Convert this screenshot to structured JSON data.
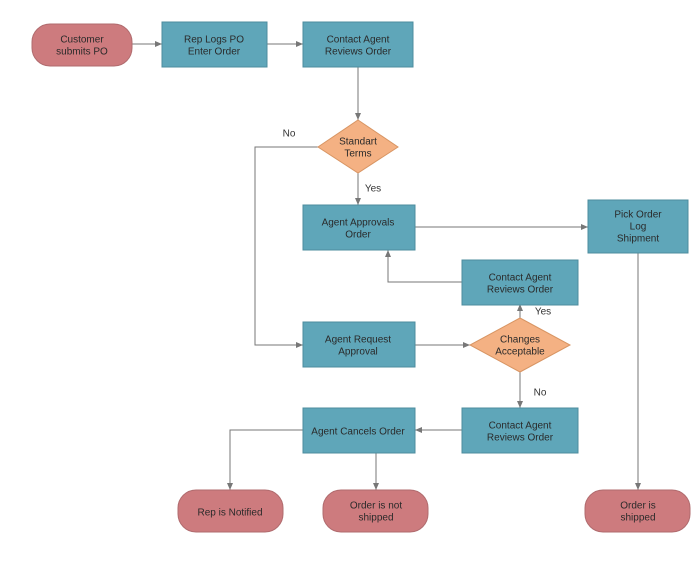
{
  "nodes": {
    "start": {
      "type": "terminator",
      "text": [
        "Customer",
        "submits PO"
      ]
    },
    "repLogs": {
      "type": "process",
      "text": [
        "Rep Logs PO",
        "Enter Order"
      ]
    },
    "contactReview1": {
      "type": "process",
      "text": [
        "Contact Agent",
        "Reviews Order"
      ]
    },
    "standardTerms": {
      "type": "decision",
      "text": [
        "Standart",
        "Terms"
      ]
    },
    "agentApprovals": {
      "type": "process",
      "text": [
        "Agent Approvals",
        "Order"
      ]
    },
    "pickOrder": {
      "type": "process",
      "text": [
        "Pick Order",
        "Log",
        "Shipment"
      ]
    },
    "contactReview2": {
      "type": "process",
      "text": [
        "Contact Agent",
        "Reviews Order"
      ]
    },
    "agentRequest": {
      "type": "process",
      "text": [
        "Agent Request",
        "Approval"
      ]
    },
    "changesAccept": {
      "type": "decision",
      "text": [
        "Changes",
        "Acceptable"
      ]
    },
    "agentCancels": {
      "type": "process",
      "text": [
        "Agent Cancels Order"
      ]
    },
    "contactReview3": {
      "type": "process",
      "text": [
        "Contact Agent",
        "Reviews Order"
      ]
    },
    "repNotified": {
      "type": "terminator",
      "text": [
        "Rep is Notified"
      ]
    },
    "orderNotShipped": {
      "type": "terminator",
      "text": [
        "Order is not",
        "shipped"
      ]
    },
    "orderShipped": {
      "type": "terminator",
      "text": [
        "Order is",
        "shipped"
      ]
    }
  },
  "labels": {
    "noTerms": "No",
    "yesTerms": "Yes",
    "yesChanges": "Yes",
    "noChanges": "No"
  },
  "chart_data": {
    "type": "flowchart",
    "title": "",
    "nodes": [
      {
        "id": "start",
        "type": "start",
        "label": "Customer submits PO"
      },
      {
        "id": "repLogs",
        "type": "process",
        "label": "Rep Logs PO Enter Order"
      },
      {
        "id": "contactReview1",
        "type": "process",
        "label": "Contact Agent Reviews Order"
      },
      {
        "id": "standardTerms",
        "type": "decision",
        "label": "Standart Terms"
      },
      {
        "id": "agentApprovals",
        "type": "process",
        "label": "Agent Approvals Order"
      },
      {
        "id": "pickOrder",
        "type": "process",
        "label": "Pick Order Log Shipment"
      },
      {
        "id": "contactReview2",
        "type": "process",
        "label": "Contact Agent Reviews Order"
      },
      {
        "id": "agentRequest",
        "type": "process",
        "label": "Agent Request Approval"
      },
      {
        "id": "changesAccept",
        "type": "decision",
        "label": "Changes Acceptable"
      },
      {
        "id": "agentCancels",
        "type": "process",
        "label": "Agent Cancels Order"
      },
      {
        "id": "contactReview3",
        "type": "process",
        "label": "Contact Agent Reviews Order"
      },
      {
        "id": "repNotified",
        "type": "end",
        "label": "Rep is Notified"
      },
      {
        "id": "orderNotShipped",
        "type": "end",
        "label": "Order is not shipped"
      },
      {
        "id": "orderShipped",
        "type": "end",
        "label": "Order is shipped"
      }
    ],
    "edges": [
      {
        "from": "start",
        "to": "repLogs",
        "label": ""
      },
      {
        "from": "repLogs",
        "to": "contactReview1",
        "label": ""
      },
      {
        "from": "contactReview1",
        "to": "standardTerms",
        "label": ""
      },
      {
        "from": "standardTerms",
        "to": "agentApprovals",
        "label": "Yes"
      },
      {
        "from": "standardTerms",
        "to": "agentRequest",
        "label": "No"
      },
      {
        "from": "agentApprovals",
        "to": "pickOrder",
        "label": ""
      },
      {
        "from": "pickOrder",
        "to": "orderShipped",
        "label": ""
      },
      {
        "from": "agentRequest",
        "to": "changesAccept",
        "label": ""
      },
      {
        "from": "changesAccept",
        "to": "contactReview2",
        "label": "Yes"
      },
      {
        "from": "contactReview2",
        "to": "agentApprovals",
        "label": ""
      },
      {
        "from": "changesAccept",
        "to": "contactReview3",
        "label": "No"
      },
      {
        "from": "contactReview3",
        "to": "agentCancels",
        "label": ""
      },
      {
        "from": "agentCancels",
        "to": "repNotified",
        "label": ""
      },
      {
        "from": "agentCancels",
        "to": "orderNotShipped",
        "label": ""
      }
    ]
  }
}
